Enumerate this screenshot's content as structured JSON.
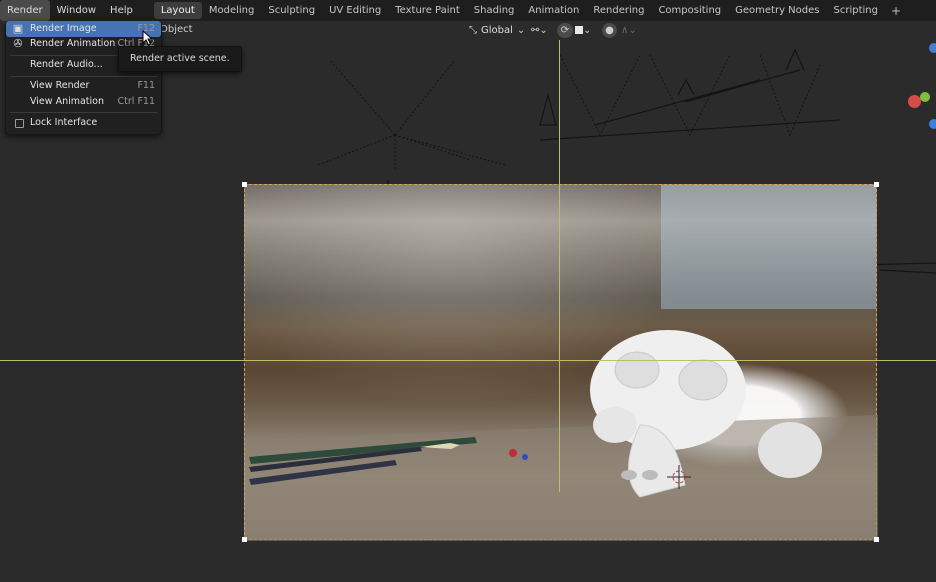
{
  "menubar": {
    "items": [
      "Render",
      "Window",
      "Help"
    ],
    "active": "Render"
  },
  "workspaces": {
    "tabs": [
      "Layout",
      "Modeling",
      "Sculpting",
      "UV Editing",
      "Texture Paint",
      "Shading",
      "Animation",
      "Rendering",
      "Compositing",
      "Geometry Nodes",
      "Scripting"
    ],
    "active": "Layout",
    "add_label": "+"
  },
  "header": {
    "object_label": "Object",
    "transform_orientation": "Global"
  },
  "render_menu": {
    "render_image": {
      "label": "Render Image",
      "shortcut": "F12"
    },
    "render_animation": {
      "label": "Render Animation",
      "shortcut": "Ctrl F12"
    },
    "render_audio": {
      "label": "Render Audio..."
    },
    "view_render": {
      "label": "View Render",
      "shortcut": "F11"
    },
    "view_animation": {
      "label": "View Animation",
      "shortcut": "Ctrl F11"
    },
    "lock_interface": {
      "label": "Lock Interface"
    }
  },
  "tooltip": {
    "text": "Render active scene."
  },
  "colors": {
    "highlight": "#4772b3",
    "guide": "#b9bf6a",
    "camera_border": "#d9a05a",
    "gizmo_x": "#d94a4a",
    "gizmo_y": "#7fbf3f",
    "gizmo_z": "#3f7fd9"
  },
  "icons": [
    "render-image-icon",
    "render-animation-icon",
    "checkbox-icon",
    "mouse-cursor-icon",
    "transform-orientation-icon",
    "chevron-down-icon",
    "link-icon",
    "snap-icon",
    "proportional-icon"
  ]
}
